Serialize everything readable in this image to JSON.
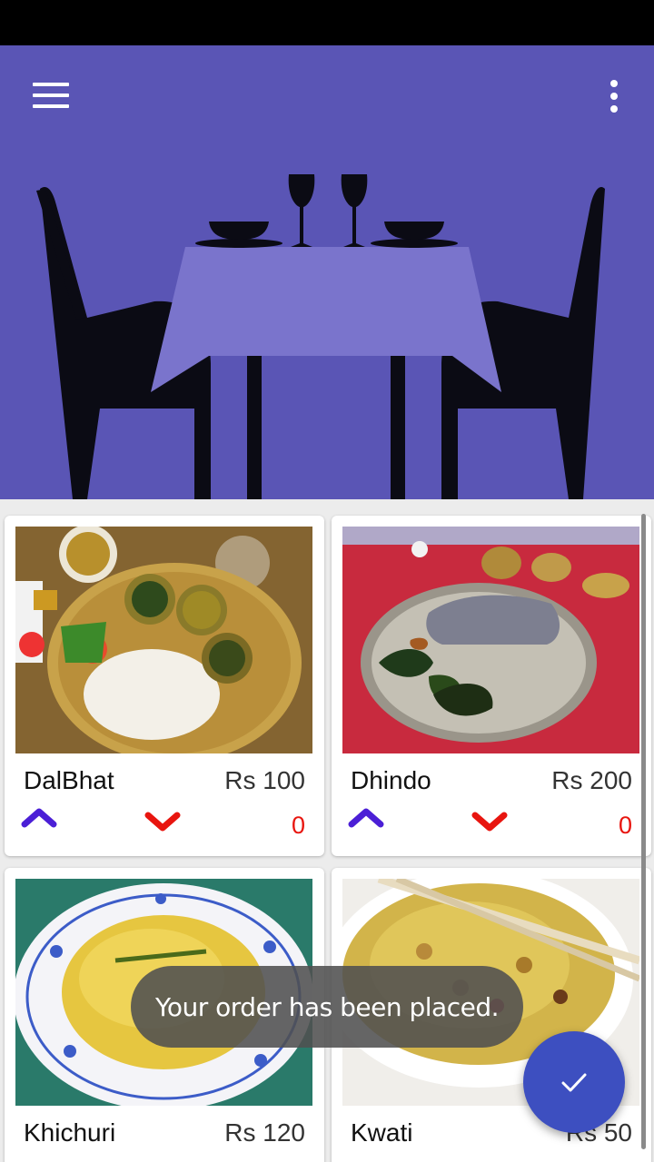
{
  "header": {
    "menu_icon": "hamburger-menu-icon",
    "more_icon": "more-vert-icon",
    "banner": "dining-table-illustration"
  },
  "menu_items": [
    {
      "name": "DalBhat",
      "price": "Rs 100",
      "quantity": "0",
      "photo": "dalbhat-photo"
    },
    {
      "name": "Dhindo",
      "price": "Rs 200",
      "quantity": "0",
      "photo": "dhindo-photo"
    },
    {
      "name": "Khichuri",
      "price": "Rs 120",
      "quantity": "",
      "photo": "khichuri-photo"
    },
    {
      "name": "Kwati",
      "price": "Rs 50",
      "quantity": "",
      "photo": "kwati-photo"
    }
  ],
  "toast": {
    "message": "Your order has been placed."
  },
  "fab": {
    "icon": "check-icon"
  },
  "colors": {
    "header_bg": "#5a55b5",
    "accent": "#3d4fc0",
    "up_arrow": "#4b1fd6",
    "down_arrow": "#e8150f"
  }
}
